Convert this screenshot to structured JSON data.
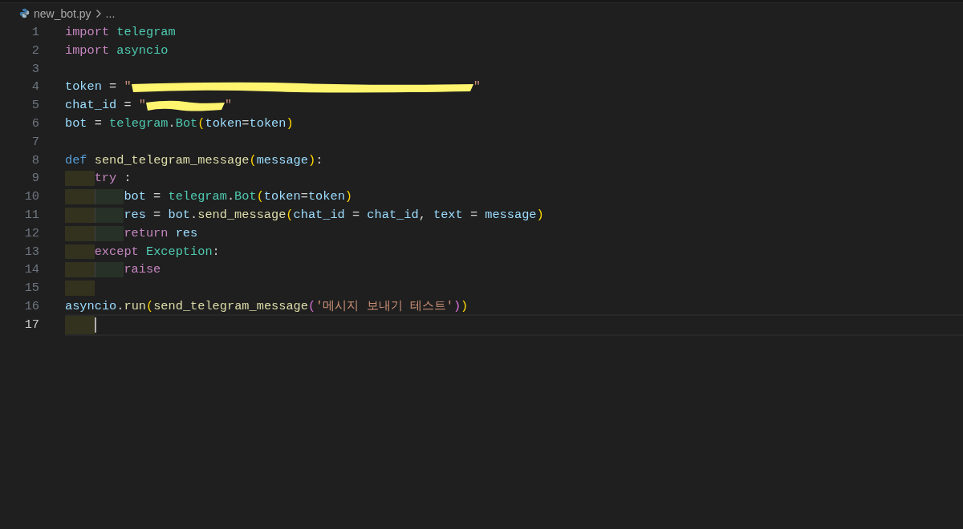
{
  "breadcrumb": {
    "file": "new_bot.py",
    "rest": "..."
  },
  "lines": [
    {
      "number": "1",
      "current": false,
      "segments": [
        {
          "kind": "code",
          "tokens": [
            {
              "kind": "kw",
              "text": "import "
            },
            {
              "kind": "module",
              "text": "telegram"
            }
          ]
        }
      ]
    },
    {
      "number": "2",
      "current": false,
      "segments": [
        {
          "kind": "code",
          "tokens": [
            {
              "kind": "kw",
              "text": "import "
            },
            {
              "kind": "module",
              "text": "asyncio"
            }
          ]
        }
      ]
    },
    {
      "number": "3",
      "current": false
    },
    {
      "number": "4",
      "current": false,
      "segments": [
        {
          "kind": "code",
          "tokens": [
            {
              "kind": "var",
              "text": "token"
            },
            {
              "kind": "plain",
              "text": " = "
            },
            {
              "kind": "str",
              "text": "\""
            }
          ]
        },
        {
          "kind": "redaction",
          "long": true
        },
        {
          "kind": "code",
          "tokens": [
            {
              "kind": "str",
              "text": "\""
            }
          ]
        }
      ]
    },
    {
      "number": "5",
      "current": false,
      "segments": [
        {
          "kind": "code",
          "tokens": [
            {
              "kind": "var",
              "text": "chat_id"
            },
            {
              "kind": "plain",
              "text": " = "
            },
            {
              "kind": "str",
              "text": "\""
            }
          ]
        },
        {
          "kind": "redaction",
          "long": false
        },
        {
          "kind": "code",
          "tokens": [
            {
              "kind": "str",
              "text": "\""
            }
          ]
        }
      ]
    },
    {
      "number": "6",
      "current": false,
      "segments": [
        {
          "kind": "code",
          "tokens": [
            {
              "kind": "var",
              "text": "bot"
            },
            {
              "kind": "plain",
              "text": " = "
            },
            {
              "kind": "module",
              "text": "telegram"
            },
            {
              "kind": "plain",
              "text": "."
            },
            {
              "kind": "module",
              "text": "Bot"
            },
            {
              "kind": "br1",
              "text": "("
            },
            {
              "kind": "var",
              "text": "token"
            },
            {
              "kind": "plain",
              "text": "="
            },
            {
              "kind": "var",
              "text": "token"
            },
            {
              "kind": "br1",
              "text": ")"
            }
          ]
        }
      ]
    },
    {
      "number": "7",
      "current": false
    },
    {
      "number": "8",
      "current": false,
      "segments": [
        {
          "kind": "code",
          "tokens": [
            {
              "kind": "storage",
              "text": "def "
            },
            {
              "kind": "fn",
              "text": "send_telegram_message"
            },
            {
              "kind": "br1",
              "text": "("
            },
            {
              "kind": "var",
              "text": "message"
            },
            {
              "kind": "br1",
              "text": ")"
            },
            {
              "kind": "plain",
              "text": ":"
            }
          ]
        }
      ]
    },
    {
      "number": "9",
      "current": false,
      "guides": [
        {
          "kind": "outer"
        }
      ],
      "segments": [
        {
          "kind": "code",
          "tokens": [
            {
              "kind": "kw",
              "text": "try"
            },
            {
              "kind": "plain",
              "text": " :"
            }
          ]
        }
      ]
    },
    {
      "number": "10",
      "current": false,
      "guides": [
        {
          "kind": "outer"
        },
        {
          "kind": "inner"
        }
      ],
      "segments": [
        {
          "kind": "code",
          "tokens": [
            {
              "kind": "var",
              "text": "bot"
            },
            {
              "kind": "plain",
              "text": " = "
            },
            {
              "kind": "module",
              "text": "telegram"
            },
            {
              "kind": "plain",
              "text": "."
            },
            {
              "kind": "module",
              "text": "Bot"
            },
            {
              "kind": "br1",
              "text": "("
            },
            {
              "kind": "var",
              "text": "token"
            },
            {
              "kind": "plain",
              "text": "="
            },
            {
              "kind": "var",
              "text": "token"
            },
            {
              "kind": "br1",
              "text": ")"
            }
          ]
        }
      ]
    },
    {
      "number": "11",
      "current": false,
      "guides": [
        {
          "kind": "outer"
        },
        {
          "kind": "inner"
        }
      ],
      "segments": [
        {
          "kind": "code",
          "tokens": [
            {
              "kind": "var",
              "text": "res"
            },
            {
              "kind": "plain",
              "text": " = "
            },
            {
              "kind": "var",
              "text": "bot"
            },
            {
              "kind": "plain",
              "text": "."
            },
            {
              "kind": "fn",
              "text": "send_message"
            },
            {
              "kind": "br1",
              "text": "("
            },
            {
              "kind": "var",
              "text": "chat_id"
            },
            {
              "kind": "plain",
              "text": " = "
            },
            {
              "kind": "var",
              "text": "chat_id"
            },
            {
              "kind": "plain",
              "text": ", "
            },
            {
              "kind": "var",
              "text": "text"
            },
            {
              "kind": "plain",
              "text": " = "
            },
            {
              "kind": "var",
              "text": "message"
            },
            {
              "kind": "br1",
              "text": ")"
            }
          ]
        }
      ]
    },
    {
      "number": "12",
      "current": false,
      "guides": [
        {
          "kind": "outer"
        },
        {
          "kind": "inner"
        }
      ],
      "segments": [
        {
          "kind": "code",
          "tokens": [
            {
              "kind": "kw",
              "text": "return "
            },
            {
              "kind": "var",
              "text": "res"
            }
          ]
        }
      ]
    },
    {
      "number": "13",
      "current": false,
      "guides": [
        {
          "kind": "outer"
        }
      ],
      "segments": [
        {
          "kind": "code",
          "tokens": [
            {
              "kind": "kw",
              "text": "except "
            },
            {
              "kind": "module",
              "text": "Exception"
            },
            {
              "kind": "plain",
              "text": ":"
            }
          ]
        }
      ]
    },
    {
      "number": "14",
      "current": false,
      "guides": [
        {
          "kind": "outer"
        },
        {
          "kind": "inner"
        }
      ],
      "segments": [
        {
          "kind": "code",
          "tokens": [
            {
              "kind": "kw",
              "text": "raise"
            }
          ]
        }
      ]
    },
    {
      "number": "15",
      "current": false,
      "guides": [
        {
          "kind": "outer"
        }
      ]
    },
    {
      "number": "16",
      "current": false,
      "segments": [
        {
          "kind": "code",
          "tokens": [
            {
              "kind": "var",
              "text": "asyncio"
            },
            {
              "kind": "plain",
              "text": "."
            },
            {
              "kind": "fn",
              "text": "run"
            },
            {
              "kind": "br1",
              "text": "("
            },
            {
              "kind": "fn",
              "text": "send_telegram_message"
            },
            {
              "kind": "br2",
              "text": "("
            },
            {
              "kind": "str",
              "text": "'메시지 보내기 테스트'"
            },
            {
              "kind": "br2",
              "text": ")"
            },
            {
              "kind": "br1",
              "text": ")"
            }
          ]
        }
      ]
    },
    {
      "number": "17",
      "current": true,
      "guides": [
        {
          "kind": "outer"
        }
      ]
    }
  ]
}
